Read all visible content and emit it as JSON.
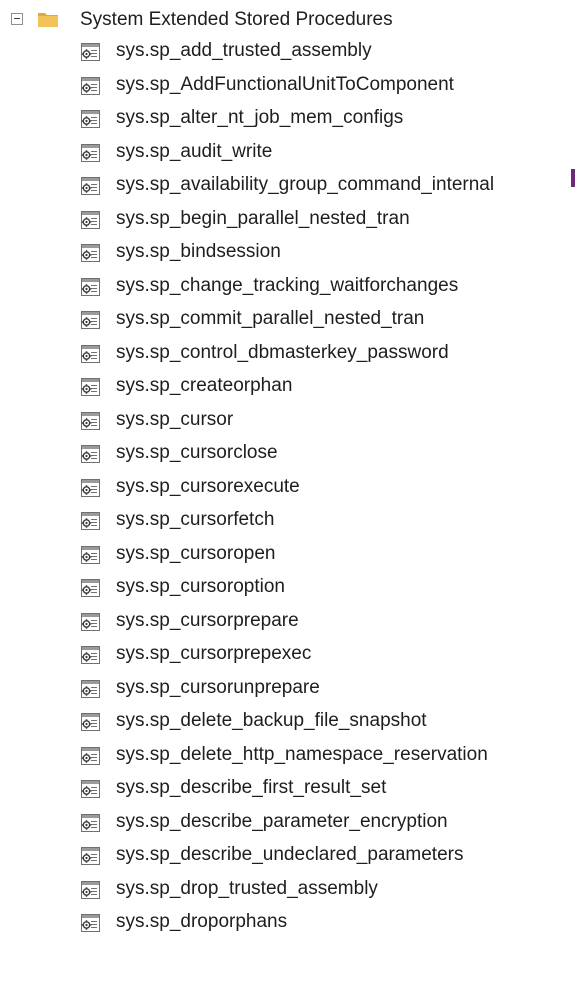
{
  "tree": {
    "folder": {
      "label": "System Extended Stored Procedures",
      "expanded": true,
      "expander_icon": "minus-icon",
      "folder_icon": "folder-icon",
      "folder_color": "#e8b54a"
    },
    "item_icon": "extended-stored-procedure-icon",
    "items": [
      "sys.sp_add_trusted_assembly",
      "sys.sp_AddFunctionalUnitToComponent",
      "sys.sp_alter_nt_job_mem_configs",
      "sys.sp_audit_write",
      "sys.sp_availability_group_command_internal",
      "sys.sp_begin_parallel_nested_tran",
      "sys.sp_bindsession",
      "sys.sp_change_tracking_waitforchanges",
      "sys.sp_commit_parallel_nested_tran",
      "sys.sp_control_dbmasterkey_password",
      "sys.sp_createorphan",
      "sys.sp_cursor",
      "sys.sp_cursorclose",
      "sys.sp_cursorexecute",
      "sys.sp_cursorfetch",
      "sys.sp_cursoropen",
      "sys.sp_cursoroption",
      "sys.sp_cursorprepare",
      "sys.sp_cursorprepexec",
      "sys.sp_cursorunprepare",
      "sys.sp_delete_backup_file_snapshot",
      "sys.sp_delete_http_namespace_reservation",
      "sys.sp_describe_first_result_set",
      "sys.sp_describe_parameter_encryption",
      "sys.sp_describe_undeclared_parameters",
      "sys.sp_drop_trusted_assembly",
      "sys.sp_droporphans"
    ]
  }
}
